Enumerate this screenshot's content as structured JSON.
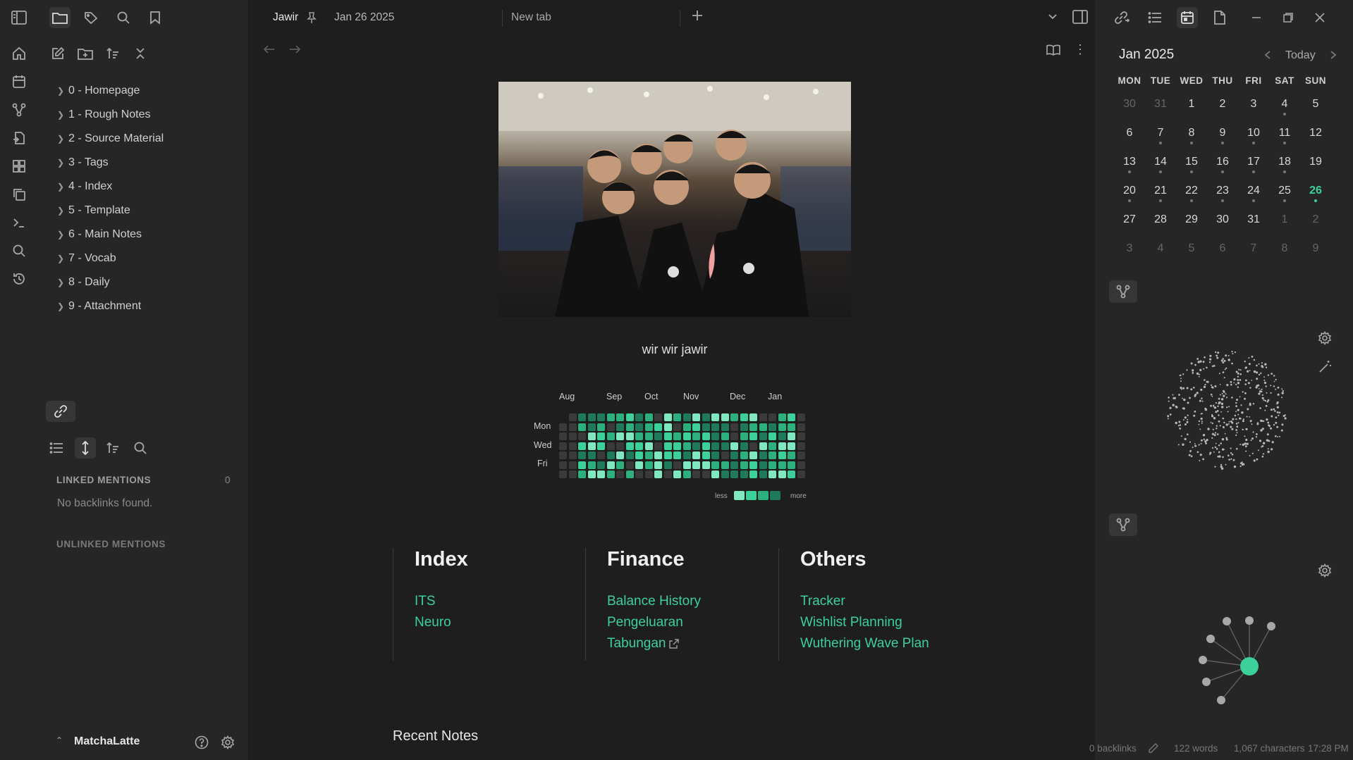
{
  "ribbon": {
    "icons": [
      "sidebar-toggle-icon",
      "home-icon",
      "calendar-icon",
      "graph-icon",
      "file-import-icon",
      "dashboard-icon",
      "copy-icon",
      "terminal-icon",
      "search-icon",
      "history-icon"
    ]
  },
  "sidebar": {
    "folders": [
      "0 - Homepage",
      "1 - Rough Notes",
      "2 - Source Material",
      "3 - Tags",
      "4 - Index",
      "5 - Template",
      "6 - Main Notes",
      "7 - Vocab",
      "8 - Daily",
      "9 - Attachment"
    ],
    "linked_mentions": "LINKED MENTIONS",
    "linked_count": "0",
    "no_backlinks": "No backlinks found.",
    "unlinked_mentions": "UNLINKED MENTIONS",
    "vault_name": "MatchaLatte"
  },
  "tabs": {
    "active_title": "Jawir",
    "active_date": "Jan 26 2025",
    "new_tab": "New tab"
  },
  "note": {
    "caption": "wir wir jawir",
    "heatmap": {
      "months": [
        "Aug",
        "Sep",
        "Oct",
        "Nov",
        "Dec",
        "Jan"
      ],
      "days": [
        "Mon",
        "Wed",
        "Fri"
      ],
      "legend_less": "less",
      "legend_more": "more",
      "colors": [
        "#3a3a3a",
        "#1f7a5c",
        "#2bb07e",
        "#3cd09a",
        "#7fe8c0"
      ]
    },
    "columns": [
      {
        "title": "Index",
        "links": [
          "ITS",
          "Neuro"
        ]
      },
      {
        "title": "Finance",
        "links": [
          "Balance History",
          "Pengeluaran",
          "Tabungan"
        ]
      },
      {
        "title": "Others",
        "links": [
          "Tracker",
          "Wishlist Planning",
          "Wuthering Wave Plan"
        ]
      }
    ],
    "recent_notes": "Recent Notes"
  },
  "calendar": {
    "month_label": "Jan 2025",
    "today_label": "Today",
    "weekdays": [
      "MON",
      "TUE",
      "WED",
      "THU",
      "FRI",
      "SAT",
      "SUN"
    ],
    "weeks": [
      [
        "30",
        "31",
        "1",
        "2",
        "3",
        "4",
        "5"
      ],
      [
        "6",
        "7",
        "8",
        "9",
        "10",
        "11",
        "12"
      ],
      [
        "13",
        "14",
        "15",
        "16",
        "17",
        "18",
        "19"
      ],
      [
        "20",
        "21",
        "22",
        "23",
        "24",
        "25",
        "26"
      ],
      [
        "27",
        "28",
        "29",
        "30",
        "31",
        "1",
        "2"
      ],
      [
        "3",
        "4",
        "5",
        "6",
        "7",
        "8",
        "9"
      ]
    ],
    "accent": "#3cd09a"
  },
  "status": {
    "backlinks": "0 backlinks",
    "words": "122 words",
    "chars": "1,067 characters",
    "time": "17:28 PM"
  }
}
